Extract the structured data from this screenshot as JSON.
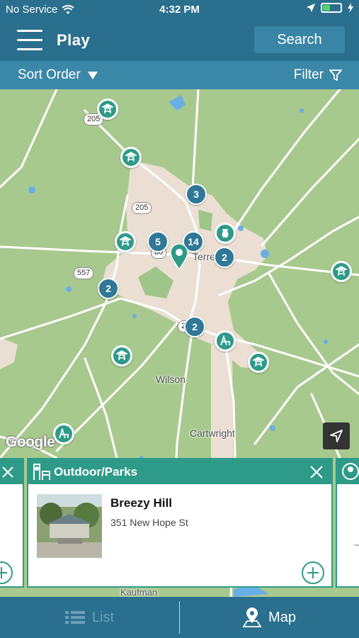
{
  "status": {
    "carrier": "No Service",
    "time": "4:32 PM",
    "battery_level": 0.4
  },
  "nav": {
    "title": "Play",
    "search_label": "Search"
  },
  "subbar": {
    "sort_label": "Sort Order",
    "filter_label": "Filter"
  },
  "map": {
    "labels": {
      "terrell": "Terrell",
      "wilson": "Wilson",
      "cartwright": "Cartwright",
      "kaufman": "Kaufman"
    },
    "shields": [
      "205",
      "205",
      "80",
      "557",
      "20"
    ],
    "clusters": [
      "3",
      "5",
      "14",
      "2",
      "2",
      "2"
    ],
    "google_logo": "Google",
    "colors": {
      "land": "#a8c98e",
      "urban": "#eadfd2",
      "water": "#6aaee6",
      "poi": "#2e9b88",
      "cluster": "#2f7897"
    }
  },
  "cards": {
    "left_partial": {
      "icon": "close-icon"
    },
    "main": {
      "category": "Outdoor/Parks",
      "name": "Breezy Hill",
      "address": "351 New Hope St"
    }
  },
  "tabs": {
    "list_label": "List",
    "map_label": "Map",
    "active": "Map"
  }
}
